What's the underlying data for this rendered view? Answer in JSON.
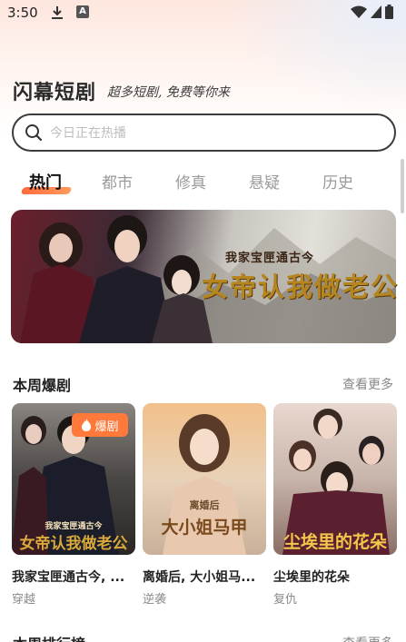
{
  "status_bar": {
    "time": "3:50",
    "icons": [
      "download-icon",
      "a-icon",
      "wifi-icon",
      "signal-icon",
      "battery-icon"
    ],
    "a_glyph": "A"
  },
  "header": {
    "title": "闪幕短剧",
    "slogan": "超多短剧, 免费等你来"
  },
  "search": {
    "placeholder": "今日正在热播",
    "value": ""
  },
  "tabs": [
    {
      "label": "热门",
      "active": true
    },
    {
      "label": "都市",
      "active": false
    },
    {
      "label": "修真",
      "active": false
    },
    {
      "label": "悬疑",
      "active": false
    },
    {
      "label": "历史",
      "active": false
    }
  ],
  "banner": {
    "title_small": "我家宝匣通古今",
    "title_large": "女帝认我做老公"
  },
  "weekly_section": {
    "title": "本周爆剧",
    "more": "查看更多"
  },
  "cards": [
    {
      "name": "我家宝匣通古今, ...",
      "tag": "穿越",
      "badge": "爆剧",
      "cover_title_small": "我家宝匣通古今",
      "cover_title_large": "女帝认我做老公"
    },
    {
      "name": "离婚后, 大小姐马...",
      "tag": "逆袭",
      "cover_title_small": "离婚后",
      "cover_title_large": "大小姐马甲"
    },
    {
      "name": "尘埃里的花朵",
      "tag": "复仇",
      "cover_title_large": "尘埃里的花朵"
    }
  ],
  "ranking_section": {
    "title": "本周排行榜",
    "more": "查看更多"
  },
  "colors": {
    "accent": "#ff7a3a",
    "tab_underline": "#ff6a3d",
    "text_primary": "#222222",
    "text_secondary": "#8a8a8a"
  }
}
